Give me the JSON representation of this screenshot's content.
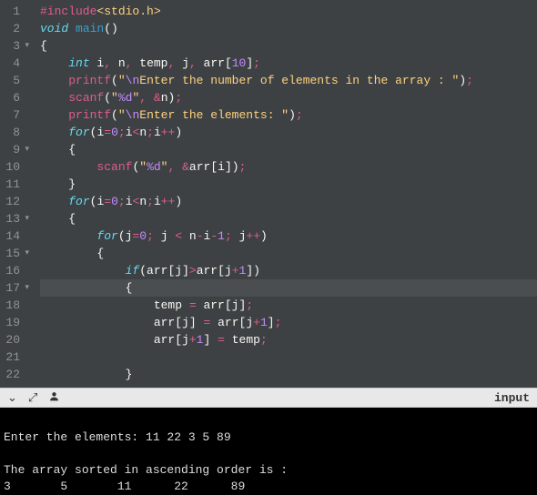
{
  "editor": {
    "lines": [
      {
        "n": 1,
        "fold": false,
        "tokens": [
          [
            "preproc",
            "#include"
          ],
          [
            "include-lib",
            "<stdio.h>"
          ]
        ]
      },
      {
        "n": 2,
        "fold": false,
        "tokens": [
          [
            "type",
            "void"
          ],
          [
            "ident",
            " "
          ],
          [
            "fn",
            "main"
          ],
          [
            "paren",
            "()"
          ]
        ]
      },
      {
        "n": 3,
        "fold": true,
        "tokens": [
          [
            "paren",
            "{"
          ]
        ]
      },
      {
        "n": 4,
        "fold": false,
        "tokens": [
          [
            "ident",
            "    "
          ],
          [
            "type",
            "int"
          ],
          [
            "ident",
            " i"
          ],
          [
            "op",
            ","
          ],
          [
            "ident",
            " n"
          ],
          [
            "op",
            ","
          ],
          [
            "ident",
            " temp"
          ],
          [
            "op",
            ","
          ],
          [
            "ident",
            " j"
          ],
          [
            "op",
            ","
          ],
          [
            "ident",
            " arr"
          ],
          [
            "paren",
            "["
          ],
          [
            "num",
            "10"
          ],
          [
            "paren",
            "]"
          ],
          [
            "op",
            ";"
          ]
        ]
      },
      {
        "n": 5,
        "fold": false,
        "tokens": [
          [
            "ident",
            "    "
          ],
          [
            "pfn",
            "printf"
          ],
          [
            "paren",
            "("
          ],
          [
            "str",
            "\""
          ],
          [
            "esc",
            "\\n"
          ],
          [
            "str",
            "Enter the number of elements in the array : \""
          ],
          [
            "paren",
            ")"
          ],
          [
            "op",
            ";"
          ]
        ]
      },
      {
        "n": 6,
        "fold": false,
        "tokens": [
          [
            "ident",
            "    "
          ],
          [
            "pfn",
            "scanf"
          ],
          [
            "paren",
            "("
          ],
          [
            "str",
            "\""
          ],
          [
            "esc",
            "%d"
          ],
          [
            "str",
            "\""
          ],
          [
            "op",
            ", "
          ],
          [
            "op",
            "&"
          ],
          [
            "ident",
            "n"
          ],
          [
            "paren",
            ")"
          ],
          [
            "op",
            ";"
          ]
        ]
      },
      {
        "n": 7,
        "fold": false,
        "tokens": [
          [
            "ident",
            "    "
          ],
          [
            "pfn",
            "printf"
          ],
          [
            "paren",
            "("
          ],
          [
            "str",
            "\""
          ],
          [
            "esc",
            "\\n"
          ],
          [
            "str",
            "Enter the elements: \""
          ],
          [
            "paren",
            ")"
          ],
          [
            "op",
            ";"
          ]
        ]
      },
      {
        "n": 8,
        "fold": false,
        "tokens": [
          [
            "ident",
            "    "
          ],
          [
            "kw",
            "for"
          ],
          [
            "paren",
            "("
          ],
          [
            "ident",
            "i"
          ],
          [
            "op",
            "="
          ],
          [
            "num",
            "0"
          ],
          [
            "op",
            ";"
          ],
          [
            "ident",
            "i"
          ],
          [
            "op",
            "<"
          ],
          [
            "ident",
            "n"
          ],
          [
            "op",
            ";"
          ],
          [
            "ident",
            "i"
          ],
          [
            "op",
            "++"
          ],
          [
            "paren",
            ")"
          ]
        ]
      },
      {
        "n": 9,
        "fold": true,
        "tokens": [
          [
            "ident",
            "    "
          ],
          [
            "paren",
            "{"
          ]
        ]
      },
      {
        "n": 10,
        "fold": false,
        "tokens": [
          [
            "ident",
            "        "
          ],
          [
            "pfn",
            "scanf"
          ],
          [
            "paren",
            "("
          ],
          [
            "str",
            "\""
          ],
          [
            "esc",
            "%d"
          ],
          [
            "str",
            "\""
          ],
          [
            "op",
            ", "
          ],
          [
            "op",
            "&"
          ],
          [
            "ident",
            "arr"
          ],
          [
            "paren",
            "["
          ],
          [
            "ident",
            "i"
          ],
          [
            "paren",
            "]"
          ],
          [
            "paren",
            ")"
          ],
          [
            "op",
            ";"
          ]
        ]
      },
      {
        "n": 11,
        "fold": false,
        "tokens": [
          [
            "ident",
            "    "
          ],
          [
            "paren",
            "}"
          ]
        ]
      },
      {
        "n": 12,
        "fold": false,
        "tokens": [
          [
            "ident",
            "    "
          ],
          [
            "kw",
            "for"
          ],
          [
            "paren",
            "("
          ],
          [
            "ident",
            "i"
          ],
          [
            "op",
            "="
          ],
          [
            "num",
            "0"
          ],
          [
            "op",
            ";"
          ],
          [
            "ident",
            "i"
          ],
          [
            "op",
            "<"
          ],
          [
            "ident",
            "n"
          ],
          [
            "op",
            ";"
          ],
          [
            "ident",
            "i"
          ],
          [
            "op",
            "++"
          ],
          [
            "paren",
            ")"
          ]
        ]
      },
      {
        "n": 13,
        "fold": true,
        "tokens": [
          [
            "ident",
            "    "
          ],
          [
            "paren",
            "{"
          ]
        ]
      },
      {
        "n": 14,
        "fold": false,
        "tokens": [
          [
            "ident",
            "        "
          ],
          [
            "kw",
            "for"
          ],
          [
            "paren",
            "("
          ],
          [
            "ident",
            "j"
          ],
          [
            "op",
            "="
          ],
          [
            "num",
            "0"
          ],
          [
            "op",
            ";"
          ],
          [
            "ident",
            " j "
          ],
          [
            "op",
            "<"
          ],
          [
            "ident",
            " n"
          ],
          [
            "op",
            "-"
          ],
          [
            "ident",
            "i"
          ],
          [
            "op",
            "-"
          ],
          [
            "num",
            "1"
          ],
          [
            "op",
            ";"
          ],
          [
            "ident",
            " j"
          ],
          [
            "op",
            "++"
          ],
          [
            "paren",
            ")"
          ]
        ]
      },
      {
        "n": 15,
        "fold": true,
        "tokens": [
          [
            "ident",
            "        "
          ],
          [
            "paren",
            "{"
          ]
        ]
      },
      {
        "n": 16,
        "fold": false,
        "tokens": [
          [
            "ident",
            "            "
          ],
          [
            "kw",
            "if"
          ],
          [
            "paren",
            "("
          ],
          [
            "ident",
            "arr"
          ],
          [
            "paren",
            "["
          ],
          [
            "ident",
            "j"
          ],
          [
            "paren",
            "]"
          ],
          [
            "op",
            ">"
          ],
          [
            "ident",
            "arr"
          ],
          [
            "paren",
            "["
          ],
          [
            "ident",
            "j"
          ],
          [
            "op",
            "+"
          ],
          [
            "num",
            "1"
          ],
          [
            "paren",
            "]"
          ],
          [
            "paren",
            ")"
          ]
        ]
      },
      {
        "n": 17,
        "fold": true,
        "hl": true,
        "tokens": [
          [
            "ident",
            "            "
          ],
          [
            "paren",
            "{"
          ]
        ]
      },
      {
        "n": 18,
        "fold": false,
        "tokens": [
          [
            "ident",
            "                temp "
          ],
          [
            "op",
            "="
          ],
          [
            "ident",
            " arr"
          ],
          [
            "paren",
            "["
          ],
          [
            "ident",
            "j"
          ],
          [
            "paren",
            "]"
          ],
          [
            "op",
            ";"
          ]
        ]
      },
      {
        "n": 19,
        "fold": false,
        "tokens": [
          [
            "ident",
            "                arr"
          ],
          [
            "paren",
            "["
          ],
          [
            "ident",
            "j"
          ],
          [
            "paren",
            "]"
          ],
          [
            "ident",
            " "
          ],
          [
            "op",
            "="
          ],
          [
            "ident",
            " arr"
          ],
          [
            "paren",
            "["
          ],
          [
            "ident",
            "j"
          ],
          [
            "op",
            "+"
          ],
          [
            "num",
            "1"
          ],
          [
            "paren",
            "]"
          ],
          [
            "op",
            ";"
          ]
        ]
      },
      {
        "n": 20,
        "fold": false,
        "tokens": [
          [
            "ident",
            "                arr"
          ],
          [
            "paren",
            "["
          ],
          [
            "ident",
            "j"
          ],
          [
            "op",
            "+"
          ],
          [
            "num",
            "1"
          ],
          [
            "paren",
            "]"
          ],
          [
            "ident",
            " "
          ],
          [
            "op",
            "="
          ],
          [
            "ident",
            " temp"
          ],
          [
            "op",
            ";"
          ]
        ]
      },
      {
        "n": 21,
        "fold": false,
        "tokens": [
          [
            "ident",
            ""
          ]
        ]
      },
      {
        "n": 22,
        "fold": false,
        "tokens": [
          [
            "ident",
            "            "
          ],
          [
            "paren",
            "}"
          ]
        ]
      }
    ]
  },
  "toolbar": {
    "input_label": "input"
  },
  "terminal": {
    "lines": [
      "",
      "Enter the elements: 11 22 3 5 89",
      "",
      "The array sorted in ascending order is :",
      "3       5       11      22      89"
    ]
  }
}
